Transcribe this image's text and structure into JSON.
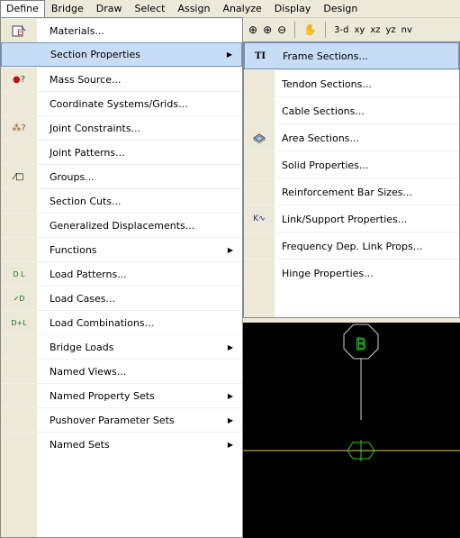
{
  "colors": {
    "canvas_bg": "#000000",
    "wire_green": "#22d022",
    "wire_white": "#d0d0d0",
    "grid_yellow": "#d6d640",
    "highlight": "#c7ddf5"
  },
  "menubar": {
    "items": [
      {
        "label": "Define",
        "active": true
      },
      {
        "label": "Bridge"
      },
      {
        "label": "Draw"
      },
      {
        "label": "Select"
      },
      {
        "label": "Assign"
      },
      {
        "label": "Analyze"
      },
      {
        "label": "Display"
      },
      {
        "label": "Design"
      }
    ]
  },
  "toolbar": {
    "view_3d": "3-d",
    "view_xy": "xy",
    "view_xz": "xz",
    "view_yz": "yz",
    "view_nv": "nv"
  },
  "define_menu": {
    "items": [
      {
        "label": "Materials...",
        "icon": "materials-icon",
        "glyph": "E"
      },
      {
        "label": "Section Properties",
        "submenu": true,
        "highlighted": true
      },
      {
        "label": "Mass Source...",
        "icon": "mass-source-icon",
        "glyph": "●?"
      },
      {
        "label": "Coordinate Systems/Grids..."
      },
      {
        "label": "Joint Constraints...",
        "icon": "joint-constraints-icon",
        "glyph": "⠿?"
      },
      {
        "label": "Joint Patterns..."
      },
      {
        "label": "Groups...",
        "icon": "groups-icon",
        "glyph": "⁄□"
      },
      {
        "label": "Section Cuts..."
      },
      {
        "label": "Generalized Displacements..."
      },
      {
        "label": "Functions",
        "submenu": true
      },
      {
        "label": "Load Patterns...",
        "icon": "load-patterns-icon",
        "glyph": "ᴰᴸ"
      },
      {
        "label": "Load Cases...",
        "icon": "load-cases-icon",
        "glyph": "✓ᴰ"
      },
      {
        "label": "Load Combinations...",
        "icon": "load-combinations-icon",
        "glyph": "ᴰ+ᴸ"
      },
      {
        "label": "Bridge Loads",
        "submenu": true
      },
      {
        "label": "Named Views..."
      },
      {
        "label": "Named Property Sets",
        "submenu": true
      },
      {
        "label": "Pushover Parameter Sets",
        "submenu": true
      },
      {
        "label": "Named Sets",
        "submenu": true
      }
    ]
  },
  "section_properties_submenu": {
    "items": [
      {
        "label": "Frame Sections...",
        "icon": "frame-sections-icon",
        "glyph": "ⲦI",
        "highlighted": true
      },
      {
        "label": "Tendon Sections..."
      },
      {
        "label": "Cable Sections..."
      },
      {
        "label": "Area Sections...",
        "icon": "area-sections-icon",
        "glyph": "◈"
      },
      {
        "label": "Solid Properties..."
      },
      {
        "label": "Reinforcement Bar Sizes..."
      },
      {
        "label": "Link/Support Properties...",
        "icon": "link-support-icon",
        "glyph": "ᴷ∿"
      },
      {
        "label": "Frequency Dep. Link Props..."
      },
      {
        "label": "Hinge Properties..."
      }
    ]
  },
  "canvas": {
    "grid_bubble_label": "B"
  }
}
